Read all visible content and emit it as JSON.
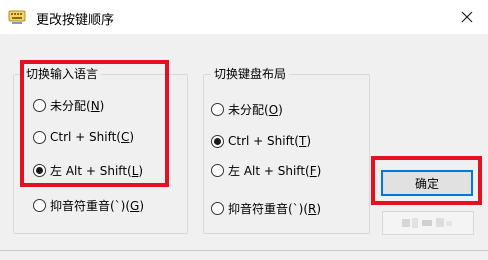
{
  "window": {
    "title": "更改按键顺序",
    "close_glyph": "✕"
  },
  "input_language_group": {
    "title": "切换输入语言",
    "options": [
      {
        "pre": "未分配(",
        "key": "N",
        "post": ")",
        "selected": false
      },
      {
        "pre": "Ctrl + Shift(",
        "key": "C",
        "post": ")",
        "selected": false
      },
      {
        "pre": "左 Alt + Shift(",
        "key": "L",
        "post": ")",
        "selected": true
      },
      {
        "pre": "抑音符重音(`)(",
        "key": "G",
        "post": ")",
        "selected": false
      }
    ]
  },
  "keyboard_layout_group": {
    "title": "切换键盘布局",
    "options": [
      {
        "pre": "未分配(",
        "key": "O",
        "post": ")",
        "selected": false
      },
      {
        "pre": "Ctrl + Shift(",
        "key": "T",
        "post": ")",
        "selected": true
      },
      {
        "pre": "左 Alt + Shift(",
        "key": "F",
        "post": ")",
        "selected": false
      },
      {
        "pre": "抑音符重音(`)(",
        "key": "R",
        "post": ")",
        "selected": false
      }
    ]
  },
  "buttons": {
    "ok_label": "确定"
  },
  "colors": {
    "highlight": "#e4121f",
    "default_button_border": "#0078d7"
  }
}
